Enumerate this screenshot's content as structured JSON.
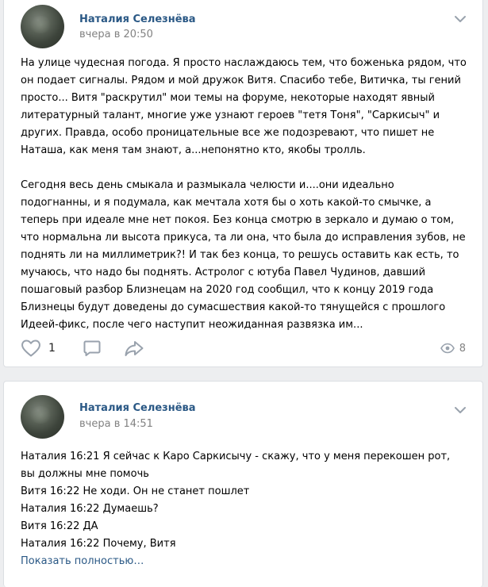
{
  "posts": [
    {
      "author": "Наталия Селезнёва",
      "time": "вчера в 20:50",
      "paragraphs": [
        "На улице чудесная погода. Я просто наслаждаюсь тем, что боженька рядом, что он подает сигналы. Рядом и мой дружок Витя. Спасибо тебе, Витичка, ты гений просто... Витя \"раскрутил\" мои темы на форуме, некоторые находят явный литературный талант, многие уже узнают героев \"тетя Тоня\", \"Саркисыч\" и других. Правда, особо проницательные все же подозревают, что пишет не Наташа, как меня там знают, а...непонятно кто, якобы тролль.",
        "Сегодня весь день смыкала и размыкала челюсти и....они идеально подогнанны, и я подумала, как мечтала хотя бы о хоть какой-то смычке, а теперь при идеале мне нет покоя. Без конца смотрю в зеркало и думаю о том, что нормальна ли высота прикуса, та ли она, что была до исправления зубов, не поднять ли на миллиметрик?! И так без конца, то решусь оставить как есть, то мучаюсь, что надо бы поднять. Астролог с ютуба Павел Чудинов, давший пошаговый разбор Близнецам на 2020 год сообщил, что к концу 2019 года Близнецы будут доведены до сумасшествия какой-то тянущейся с прошлого Идеей-фикс, после чего наступит неожиданная развязка им..."
      ],
      "likes": "1",
      "views": "8"
    },
    {
      "author": "Наталия Селезнёва",
      "time": "вчера в 14:51",
      "lines": [
        "Наталия 16:21 Я сейчас к Каро Саркисычу - скажу, что у меня перекошен рот, вы должны мне помочь",
        "Витя 16:22 Не ходи. Он не станет пошлет",
        "Наталия 16:22 Думаешь?",
        "Витя 16:22 ДА",
        "Наталия 16:22 Почему, Витя"
      ],
      "show_more": "Показать полностью…"
    }
  ],
  "icons": {
    "chevron": "chevron-down-icon",
    "like": "heart-icon",
    "comment": "comment-icon",
    "share": "share-icon",
    "views": "eye-icon"
  },
  "colors": {
    "link": "#2a5885",
    "muted": "#828282",
    "icon": "#99a2ad",
    "background": "#edeef0"
  }
}
